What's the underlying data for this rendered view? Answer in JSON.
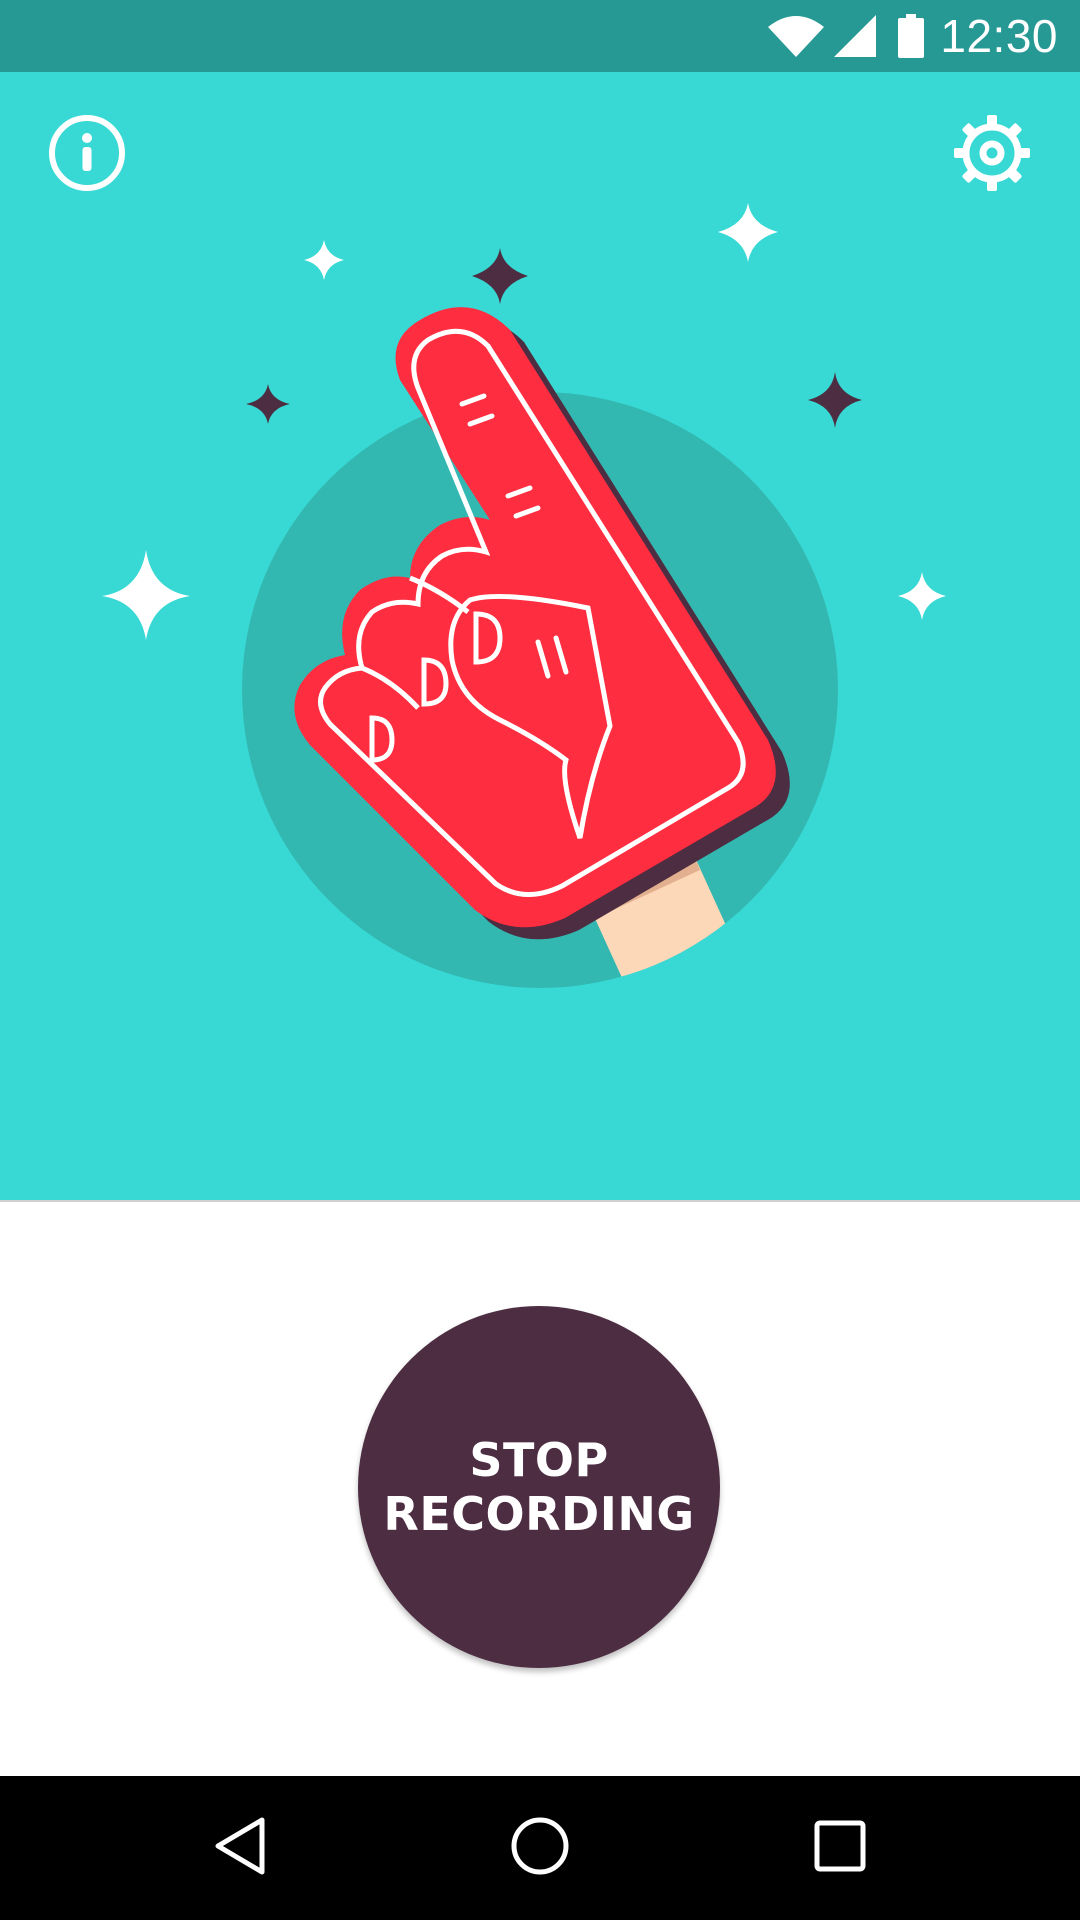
{
  "status_bar": {
    "time": "12:30",
    "icons": [
      "wifi-icon",
      "cell-signal-icon",
      "battery-icon"
    ],
    "background": "#279994"
  },
  "hero": {
    "background": "#38d9d4",
    "illustration": "foam-finger-illustration",
    "info_icon": "info-icon",
    "settings_icon": "gear-icon"
  },
  "record_button": {
    "line1": "STOP",
    "line2": "RECORDING",
    "color": "#4d2d41"
  },
  "nav_bar": {
    "icons": [
      "back-icon",
      "home-icon",
      "recents-icon"
    ]
  },
  "colors": {
    "accent_red": "#ff2d40",
    "dark_plum": "#4d2d41",
    "circle_shade": "#33b8b1",
    "stick": "#fdd8b8"
  }
}
